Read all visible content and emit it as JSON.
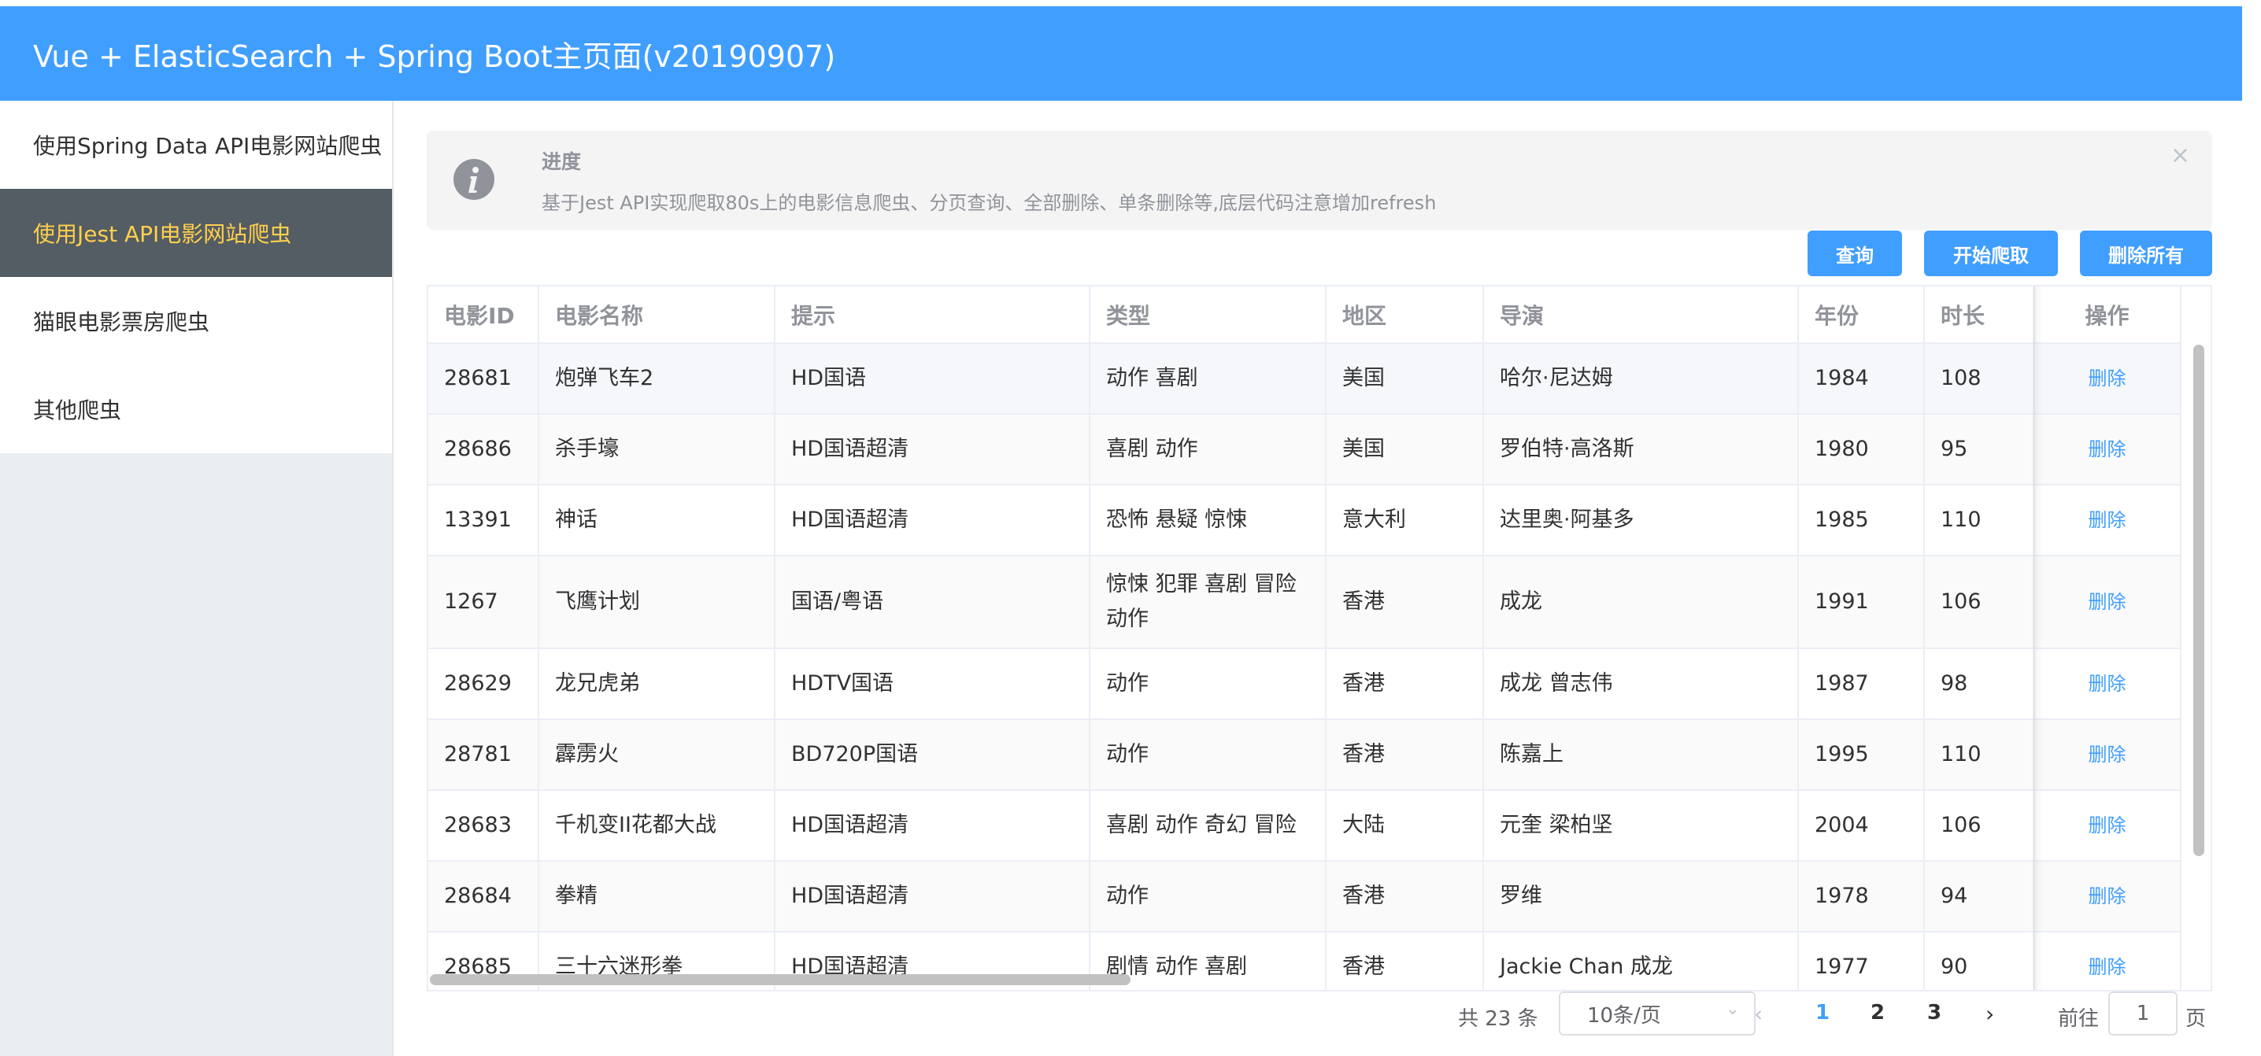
{
  "header": {
    "title": "Vue + ElasticSearch + Spring Boot主页面(v20190907)"
  },
  "sidebar": {
    "items": [
      {
        "label": "使用Spring Data API电影网站爬虫"
      },
      {
        "label": "使用Jest API电影网站爬虫"
      },
      {
        "label": "猫眼电影票房爬虫"
      },
      {
        "label": "其他爬虫"
      }
    ]
  },
  "alert": {
    "title": "进度",
    "desc": "基于Jest API实现爬取80s上的电影信息爬虫、分页查询、全部删除、单条删除等,底层代码注意增加refresh",
    "close": "×"
  },
  "toolbar": {
    "query": "查询",
    "crawl": "开始爬取",
    "delete_all": "删除所有"
  },
  "table": {
    "headers": [
      "电影ID",
      "电影名称",
      "提示",
      "类型",
      "地区",
      "导演",
      "年份",
      "时长",
      "操作"
    ],
    "delete_label": "删除",
    "rows": [
      [
        "28681",
        "炮弹飞车2",
        "HD国语",
        "动作 喜剧",
        "美国",
        "哈尔·尼达姆",
        "1984",
        "108"
      ],
      [
        "28686",
        "杀手壕",
        "HD国语超清",
        "喜剧 动作",
        "美国",
        "罗伯特·高洛斯",
        "1980",
        "95"
      ],
      [
        "13391",
        "神话",
        "HD国语超清",
        "恐怖 悬疑 惊悚",
        "意大利",
        "达里奥·阿基多",
        "1985",
        "110"
      ],
      [
        "1267",
        "飞鹰计划",
        "国语/粤语",
        "惊悚 犯罪 喜剧 冒险 动作",
        "香港",
        "成龙",
        "1991",
        "106"
      ],
      [
        "28629",
        "龙兄虎弟",
        "HDTV国语",
        "动作",
        "香港",
        "成龙 曾志伟",
        "1987",
        "98"
      ],
      [
        "28781",
        "霹雳火",
        "BD720P国语",
        "动作",
        "香港",
        "陈嘉上",
        "1995",
        "110"
      ],
      [
        "28683",
        "千机变II花都大战",
        "HD国语超清",
        "喜剧 动作 奇幻 冒险",
        "大陆",
        "元奎 梁柏坚",
        "2004",
        "106"
      ],
      [
        "28684",
        "拳精",
        "HD国语超清",
        "动作",
        "香港",
        "罗维",
        "1978",
        "94"
      ],
      [
        "28685",
        "三十六迷形拳",
        "HD国语超清",
        "剧情 动作 喜剧",
        "香港",
        "Jackie Chan 成龙",
        "1977",
        "90"
      ]
    ]
  },
  "pagination": {
    "total": "共 23 条",
    "page_size": "10条/页",
    "pages": [
      "1",
      "2",
      "3"
    ],
    "goto_label": "前往",
    "goto_value": "1",
    "page_unit": "页"
  },
  "colors": {
    "primary": "#409eff",
    "menu_active_bg": "#545c64",
    "menu_active_text": "#ffd04b"
  }
}
